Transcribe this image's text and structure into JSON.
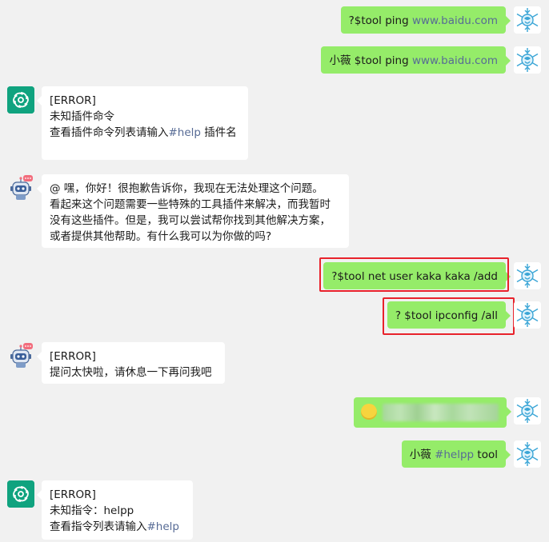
{
  "messages": [
    {
      "id": "m1",
      "side": "right",
      "text_a": "?$tool ping ",
      "link": "www.baidu.com",
      "text_b": ""
    },
    {
      "id": "m2",
      "side": "right",
      "text_a": "小薇 $tool ping ",
      "link": "www.baidu.com",
      "text_b": ""
    },
    {
      "id": "m3",
      "side": "left",
      "avatar": "chatgpt",
      "lines": [
        "[ERROR]",
        "未知插件命令"
      ],
      "line3_a": "查看插件命令列表请输入",
      "line3_link": "#help",
      "line3_b": " 插件名"
    },
    {
      "id": "m4",
      "side": "left",
      "avatar": "robot",
      "lines": [
        "@ 嘿，你好！很抱歉告诉你，我现在无法处理这个问题。",
        "看起来这个问题需要一些特殊的工具插件来解决，而我暂时",
        "没有这些插件。但是，我可以尝试帮你找到其他解决方案，",
        "或者提供其他帮助。有什么我可以为你做的吗?"
      ]
    },
    {
      "id": "m5",
      "side": "right",
      "text": "?$tool net user kaka kaka /add",
      "highlighted": true
    },
    {
      "id": "m6",
      "side": "right",
      "text": "? $tool ipconfig /all",
      "highlighted": true
    },
    {
      "id": "m7",
      "side": "left",
      "avatar": "robot",
      "lines": [
        "[ERROR]",
        "提问太快啦，请休息一下再问我吧"
      ]
    },
    {
      "id": "m8",
      "side": "right",
      "blurred": true
    },
    {
      "id": "m9",
      "side": "right",
      "text_a": "小薇 ",
      "link": "#helpp",
      "text_b": " tool"
    },
    {
      "id": "m10",
      "side": "left",
      "avatar": "chatgpt",
      "lines": [
        "[ERROR]",
        "未知指令：helpp"
      ],
      "line3_a": "查看指令列表请输入",
      "line3_link": "#help",
      "line3_b": ""
    }
  ],
  "icons": {
    "user": "snowflake-avatar-icon",
    "gpt": "chatgpt-logo-icon",
    "robot": "robot-avatar-icon"
  },
  "colors": {
    "bubble_green": "#95ec69",
    "bubble_white": "#ffffff",
    "link": "#576b95",
    "highlight": "#e8222b",
    "gpt": "#10a37f"
  }
}
